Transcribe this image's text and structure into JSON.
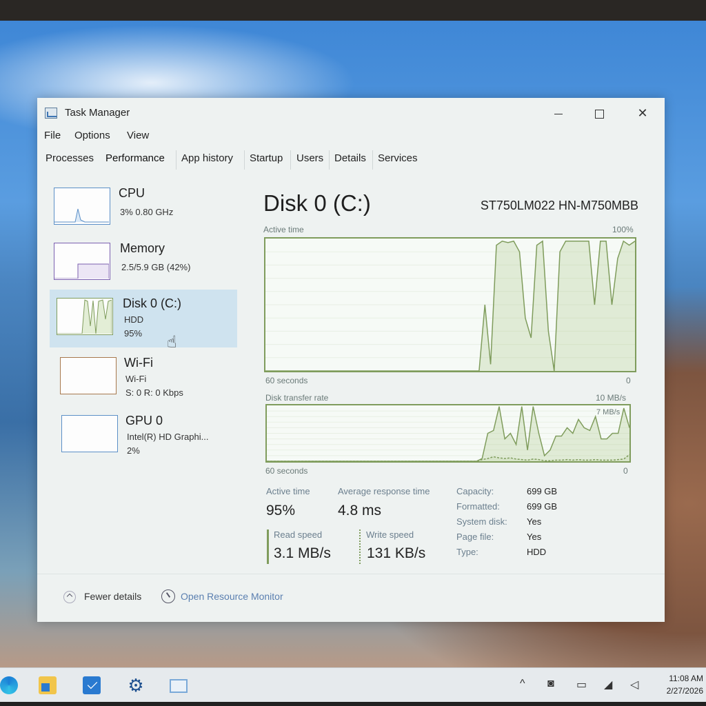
{
  "window": {
    "title": "Task Manager",
    "menu": [
      "File",
      "Options",
      "View"
    ],
    "tabs": [
      "Processes",
      "Performance",
      "App history",
      "Startup",
      "Users",
      "Details",
      "Services"
    ],
    "active_tab": "Performance"
  },
  "sidebar": {
    "items": [
      {
        "title": "CPU",
        "line1": "3% 0.80 GHz",
        "line2": ""
      },
      {
        "title": "Memory",
        "line1": "2.5/5.9 GB (42%)",
        "line2": ""
      },
      {
        "title": "Disk 0 (C:)",
        "line1": "HDD",
        "line2": "95%"
      },
      {
        "title": "Wi-Fi",
        "line1": "Wi-Fi",
        "line2": "S: 0 R: 0 Kbps"
      },
      {
        "title": "GPU 0",
        "line1": "Intel(R) HD Graphi...",
        "line2": "2%"
      }
    ],
    "selected": "Disk 0 (C:)"
  },
  "main": {
    "title": "Disk 0 (C:)",
    "model": "ST750LM022 HN-M750MBB",
    "graph1": {
      "label": "Active time",
      "max_label": "100%",
      "x_label": "60 seconds",
      "min_label": "0"
    },
    "graph2": {
      "label": "Disk transfer rate",
      "max_label": "10 MB/s",
      "mid_label": "7 MB/s",
      "x_label": "60 seconds",
      "min_label": "0"
    },
    "stats": {
      "active_time_label": "Active time",
      "active_time_value": "95%",
      "response_label": "Average response time",
      "response_value": "4.8 ms",
      "read_label": "Read speed",
      "read_value": "3.1 MB/s",
      "write_label": "Write speed",
      "write_value": "131 KB/s"
    },
    "properties": [
      {
        "key": "Capacity:",
        "value": "699 GB"
      },
      {
        "key": "Formatted:",
        "value": "699 GB"
      },
      {
        "key": "System disk:",
        "value": "Yes"
      },
      {
        "key": "Page file:",
        "value": "Yes"
      },
      {
        "key": "Type:",
        "value": "HDD"
      }
    ]
  },
  "footer": {
    "fewer_details": "Fewer details",
    "open_monitor": "Open Resource Monitor"
  },
  "taskbar": {
    "icons": [
      "edge-icon",
      "file-explorer-icon",
      "mail-icon",
      "settings-icon",
      "task-manager-icon"
    ],
    "tray_icons": [
      "chevron-up-icon",
      "meet-icon",
      "battery-icon",
      "wifi-icon",
      "volume-icon"
    ],
    "time": "11:08 AM",
    "date": "2/27/2026"
  },
  "chart_data": [
    {
      "type": "area",
      "title": "Active time",
      "xlabel": "60 seconds",
      "ylim": [
        0,
        100
      ],
      "series": [
        {
          "values": [
            0,
            0,
            0,
            0,
            0,
            0,
            0,
            0,
            0,
            0,
            0,
            0,
            0,
            0,
            0,
            0,
            0,
            0,
            0,
            0,
            0,
            0,
            0,
            0,
            0,
            0,
            0,
            0,
            0,
            0,
            0,
            0,
            0,
            0,
            0,
            0,
            0,
            0,
            50,
            5,
            95,
            98,
            97,
            98,
            90,
            40,
            25,
            95,
            98,
            30,
            0,
            90,
            98,
            98,
            98,
            98,
            98,
            50,
            98,
            98,
            50,
            85,
            98,
            95,
            98
          ]
        }
      ]
    },
    {
      "type": "area",
      "title": "Disk transfer rate",
      "xlabel": "60 seconds",
      "ylim": [
        0,
        10
      ],
      "series": [
        {
          "values": [
            0,
            0,
            0,
            0,
            0,
            0,
            0,
            0,
            0,
            0,
            0,
            0,
            0,
            0,
            0,
            0,
            0,
            0,
            0,
            0,
            0,
            0,
            0,
            0,
            0,
            0,
            0,
            0,
            0,
            0,
            0,
            0,
            0,
            0,
            0,
            0,
            0,
            0,
            0.5,
            5,
            5.5,
            9.8,
            4,
            5,
            3,
            9.8,
            2,
            9.8,
            5,
            1,
            2,
            4.5,
            4.5,
            6,
            5,
            7.5,
            6,
            5.5,
            8,
            4,
            4,
            5,
            5,
            9.5,
            6
          ]
        },
        {
          "values": [
            0,
            0,
            0,
            0,
            0,
            0,
            0,
            0,
            0,
            0,
            0,
            0,
            0,
            0,
            0,
            0,
            0,
            0,
            0,
            0,
            0,
            0,
            0,
            0,
            0,
            0,
            0,
            0,
            0,
            0,
            0,
            0,
            0,
            0,
            0,
            0,
            0,
            0,
            0.3,
            0.5,
            0.8,
            0.6,
            0.5,
            0.6,
            0.4,
            0.3,
            0.2,
            0.4,
            0.3,
            0.1,
            0.1,
            0.2,
            0.2,
            0.3,
            0.2,
            0.3,
            0.2,
            0.2,
            0.3,
            0.2,
            0.2,
            0.2,
            0.3,
            0.4,
            1.2
          ]
        }
      ]
    }
  ]
}
